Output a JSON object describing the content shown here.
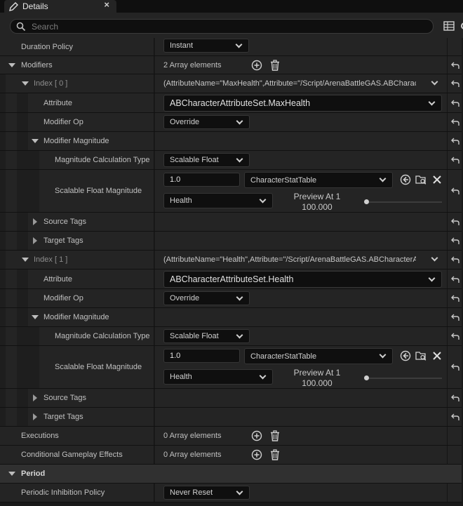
{
  "window": {
    "tab_title": "Details",
    "close_glyph": "×"
  },
  "search": {
    "placeholder": "Search"
  },
  "rows": {
    "duration_policy": {
      "label": "Duration Policy",
      "value": "Instant"
    },
    "modifiers": {
      "label": "Modifiers",
      "value": "2 Array elements"
    },
    "modifier0": {
      "index_label": "Index [ 0 ]",
      "summary": "(AttributeName=\"MaxHealth\",Attribute=\"/Script/ArenaBattleGAS.ABCharacterAttributeSet.MaxHealth\")",
      "attribute_label": "Attribute",
      "attribute_value": "ABCharacterAttributeSet.MaxHealth",
      "op_label": "Modifier Op",
      "op_value": "Override",
      "magnitude_label": "Modifier Magnitude",
      "calc_type_label": "Magnitude Calculation Type",
      "calc_type_value": "Scalable Float",
      "scalable_label": "Scalable Float Magnitude",
      "scalable_value": "1.0",
      "curve_table": "CharacterStatTable",
      "row_name": "Health",
      "preview_title": "Preview At 1",
      "preview_value": "100.000",
      "source_tags": "Source Tags",
      "target_tags": "Target Tags"
    },
    "modifier1": {
      "index_label": "Index [ 1 ]",
      "summary": "(AttributeName=\"Health\",Attribute=\"/Script/ArenaBattleGAS.ABCharacterAttributeSet.Health\")",
      "attribute_label": "Attribute",
      "attribute_value": "ABCharacterAttributeSet.Health",
      "op_label": "Modifier Op",
      "op_value": "Override",
      "magnitude_label": "Modifier Magnitude",
      "calc_type_label": "Magnitude Calculation Type",
      "calc_type_value": "Scalable Float",
      "scalable_label": "Scalable Float Magnitude",
      "scalable_value": "1.0",
      "curve_table": "CharacterStatTable",
      "row_name": "Health",
      "preview_title": "Preview At 1",
      "preview_value": "100.000",
      "source_tags": "Source Tags",
      "target_tags": "Target Tags"
    },
    "executions": {
      "label": "Executions",
      "value": "0 Array elements"
    },
    "conditional": {
      "label": "Conditional Gameplay Effects",
      "value": "0 Array elements"
    },
    "period": {
      "label": "Period"
    },
    "periodic_inhibition": {
      "label": "Periodic Inhibition Policy",
      "value": "Never Reset"
    }
  },
  "icons": {
    "tab": "pencil-icon",
    "search": "search-icon",
    "add": "plus-circle-icon",
    "delete": "trash-icon",
    "reset": "reset-arrow-icon",
    "use_selected": "use-selected-icon",
    "browse": "browse-folder-icon",
    "clear": "clear-x-icon"
  },
  "colors": {
    "panel": "#242424",
    "category": "#303030",
    "field": "#0f0f0f",
    "text": "#c0c0c0"
  }
}
